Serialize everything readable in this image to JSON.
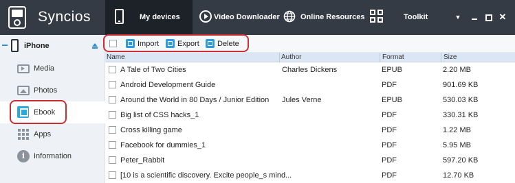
{
  "app": {
    "title": "Syncios"
  },
  "nav": {
    "tabs": [
      {
        "label": "My devices",
        "icon": "phone-icon",
        "active": true
      },
      {
        "label": "Video Downloader",
        "icon": "play-icon",
        "active": false
      },
      {
        "label": "Online Resources",
        "icon": "globe-icon",
        "active": false
      },
      {
        "label": "Toolkit",
        "icon": "grid-icon",
        "active": false
      }
    ]
  },
  "sidebar": {
    "device_name": "iPhone",
    "items": [
      {
        "label": "Media",
        "icon": "tv-icon",
        "active": false
      },
      {
        "label": "Photos",
        "icon": "image-icon",
        "active": false
      },
      {
        "label": "Ebook",
        "icon": "book-icon",
        "active": true
      },
      {
        "label": "Apps",
        "icon": "apps-grid-icon",
        "active": false
      },
      {
        "label": "Information",
        "icon": "info-icon",
        "active": false
      }
    ]
  },
  "toolbar": {
    "import_label": "Import",
    "export_label": "Export",
    "delete_label": "Delete"
  },
  "table": {
    "columns": [
      "Name",
      "Author",
      "Format",
      "Size"
    ],
    "rows": [
      {
        "name": "A Tale of Two Cities",
        "author": "Charles Dickens",
        "format": "EPUB",
        "size": "2.20 MB"
      },
      {
        "name": "Android Development Guide",
        "author": "",
        "format": "PDF",
        "size": "901.69 KB"
      },
      {
        "name": "Around the World in 80 Days / Junior Edition",
        "author": "Jules Verne",
        "format": "EPUB",
        "size": "530.03 KB"
      },
      {
        "name": "Big list of CSS hacks_1",
        "author": "",
        "format": "PDF",
        "size": "330.31 KB"
      },
      {
        "name": "Cross killing game",
        "author": "",
        "format": "PDF",
        "size": "1.22 MB"
      },
      {
        "name": "Facebook for dummies_1",
        "author": "",
        "format": "PDF",
        "size": "5.95 MB"
      },
      {
        "name": "Peter_Rabbit",
        "author": "",
        "format": "PDF",
        "size": "597.20 KB"
      },
      {
        "name": "[10 is a scientific discovery. Excite people_s mind...",
        "author": "",
        "format": "PDF",
        "size": "12.70 KB"
      }
    ]
  },
  "colors": {
    "topbar": "#343b45",
    "active_tab": "#1d2229",
    "accent": "#2c9be0",
    "highlight": "#cc2d33",
    "header": "#dbe6f4"
  }
}
